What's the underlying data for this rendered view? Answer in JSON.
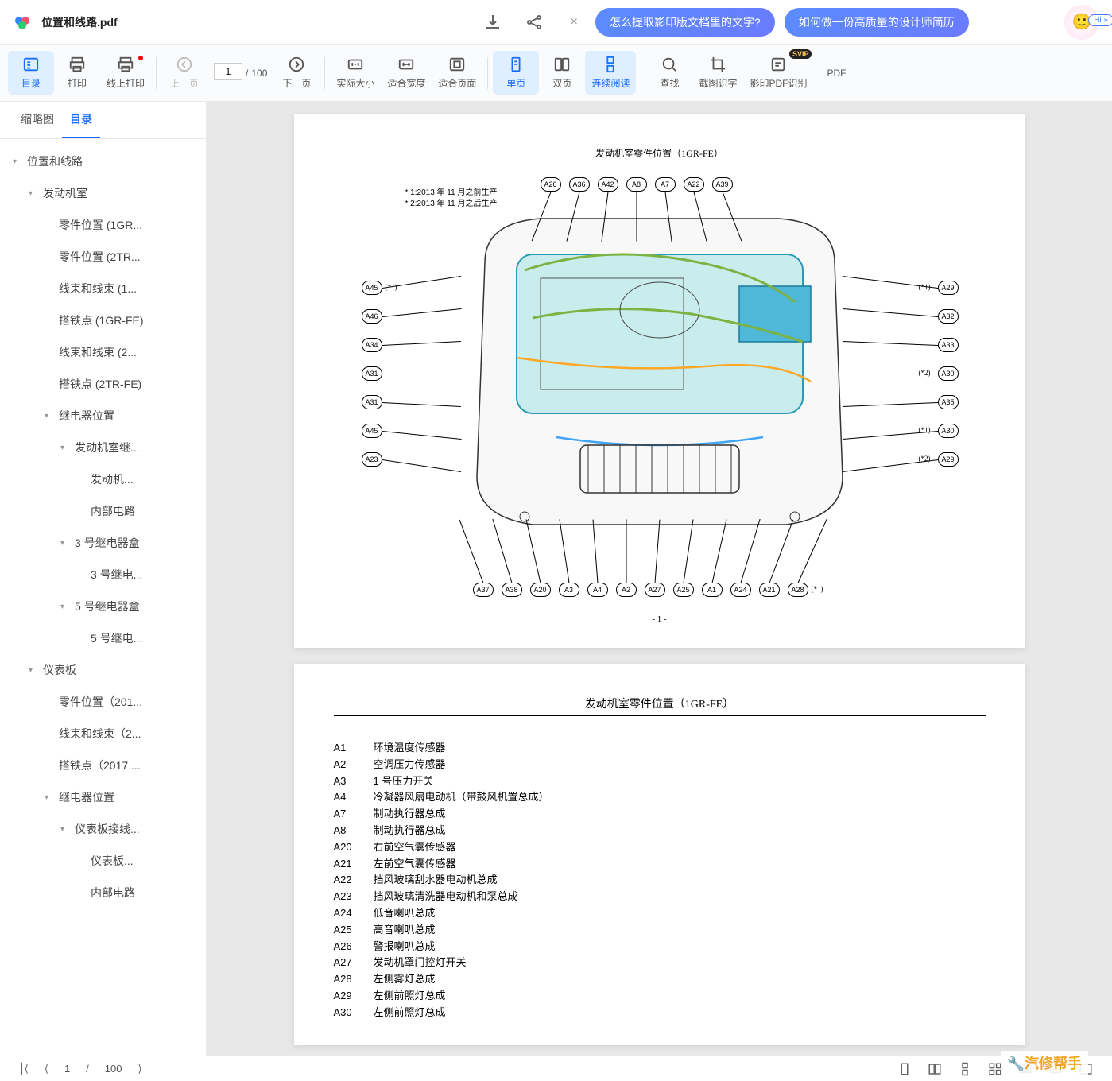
{
  "doc": {
    "title": "位置和线路.pdf"
  },
  "topbar": {
    "pill1": "怎么提取影印版文档里的文字?",
    "pill2": "如何做一份高质量的设计师简历",
    "hi": "Hi »"
  },
  "toolbar": {
    "outline": "目录",
    "print": "打印",
    "cloud_print": "线上打印",
    "prev": "上一页",
    "page_current": "1",
    "page_sep": "/",
    "page_total": "100",
    "next": "下一页",
    "actual": "实际大小",
    "fit_width": "适合宽度",
    "fit_page": "适合页面",
    "single": "单页",
    "double": "双页",
    "continuous": "连续阅读",
    "search": "查找",
    "ocr_screenshot": "截图识字",
    "pdf_ocr": "影印PDF识别",
    "pdf_label": "PDF"
  },
  "side_tabs": {
    "thumb": "缩略图",
    "outline": "目录"
  },
  "outline": [
    {
      "label": "位置和线路",
      "level": 0,
      "expand": true
    },
    {
      "label": "发动机室",
      "level": 1,
      "expand": true
    },
    {
      "label": "零件位置 (1GR...",
      "level": 2
    },
    {
      "label": "零件位置 (2TR...",
      "level": 2
    },
    {
      "label": "线束和线束 (1...",
      "level": 2
    },
    {
      "label": "搭铁点 (1GR-FE)",
      "level": 2
    },
    {
      "label": "线束和线束 (2...",
      "level": 2
    },
    {
      "label": "搭铁点 (2TR-FE)",
      "level": 2
    },
    {
      "label": "继电器位置",
      "level": 2,
      "expand": true
    },
    {
      "label": "发动机室继...",
      "level": 3,
      "expand": true
    },
    {
      "label": "发动机...",
      "level": 4
    },
    {
      "label": "内部电路",
      "level": 4
    },
    {
      "label": "3 号继电器盒",
      "level": 3,
      "expand": true
    },
    {
      "label": "3 号继电...",
      "level": 4
    },
    {
      "label": "5 号继电器盒",
      "level": 3,
      "expand": true
    },
    {
      "label": "5 号继电...",
      "level": 4
    },
    {
      "label": "仪表板",
      "level": 1,
      "expand": true
    },
    {
      "label": "零件位置（201...",
      "level": 2
    },
    {
      "label": "线束和线束（2...",
      "level": 2
    },
    {
      "label": "搭铁点（2017 ...",
      "level": 2
    },
    {
      "label": "继电器位置",
      "level": 2,
      "expand": true
    },
    {
      "label": "仪表板接线...",
      "level": 3,
      "expand": true
    },
    {
      "label": "仪表板...",
      "level": 4
    },
    {
      "label": "内部电路",
      "level": 4
    }
  ],
  "page1": {
    "title": "发动机室零件位置（1GR-FE）",
    "note1": "* 1:2013 年 11 月之前生产",
    "note2": "* 2:2013 年 11 月之后生产",
    "page_num": "- 1 -",
    "labels_top": [
      "A26",
      "A36",
      "A42",
      "A8",
      "A7",
      "A22",
      "A39"
    ],
    "labels_left": [
      {
        "t": "A45",
        "a": "(*1)"
      },
      {
        "t": "A46",
        "a": ""
      },
      {
        "t": "A34",
        "a": ""
      },
      {
        "t": "A31",
        "a": ""
      },
      {
        "t": "A31",
        "a": ""
      },
      {
        "t": "A45",
        "a": ""
      },
      {
        "t": "A23",
        "a": ""
      }
    ],
    "labels_right": [
      {
        "t": "A29",
        "a": "(*1)"
      },
      {
        "t": "A32",
        "a": ""
      },
      {
        "t": "A33",
        "a": ""
      },
      {
        "t": "A30",
        "a": "(*2)"
      },
      {
        "t": "A35",
        "a": ""
      },
      {
        "t": "A30",
        "a": "(*1)"
      },
      {
        "t": "A29",
        "a": "(*2)"
      }
    ],
    "labels_bottom": [
      "A37",
      "A38",
      "A20",
      "A3",
      "A4",
      "A2",
      "A27",
      "A25",
      "A1",
      "A24",
      "A21",
      "A28"
    ],
    "bottom_note": "(*1)"
  },
  "page2": {
    "title": "发动机室零件位置（1GR-FE）",
    "rows": [
      {
        "c": "A1",
        "d": "环境温度传感器"
      },
      {
        "c": "A2",
        "d": "空调压力传感器"
      },
      {
        "c": "A3",
        "d": "1 号压力开关"
      },
      {
        "c": "A4",
        "d": "冷凝器风扇电动机（带鼓风机置总成）"
      },
      {
        "c": "A7",
        "d": "制动执行器总成"
      },
      {
        "c": "A8",
        "d": "制动执行器总成"
      },
      {
        "c": "A20",
        "d": "右前空气囊传感器"
      },
      {
        "c": "A21",
        "d": "左前空气囊传感器"
      },
      {
        "c": "A22",
        "d": "挡风玻璃刮水器电动机总成"
      },
      {
        "c": "A23",
        "d": "挡风玻璃清洗器电动机和泵总成"
      },
      {
        "c": "A24",
        "d": "低音喇叭总成"
      },
      {
        "c": "A25",
        "d": "高音喇叭总成"
      },
      {
        "c": "A26",
        "d": "警报喇叭总成"
      },
      {
        "c": "A27",
        "d": "发动机罩门控灯开关"
      },
      {
        "c": "A28",
        "d": "左侧雾灯总成"
      },
      {
        "c": "A29",
        "d": "左侧前照灯总成"
      },
      {
        "c": "A30",
        "d": "左侧前照灯总成"
      }
    ]
  },
  "bottom": {
    "page_current": "1",
    "sep": "/",
    "total": "100"
  },
  "watermark": "🔧汽修帮手"
}
